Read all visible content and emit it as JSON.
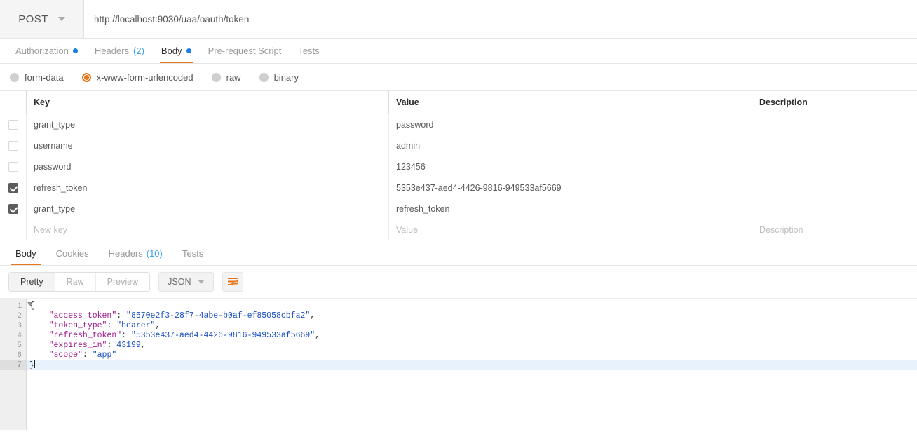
{
  "request": {
    "method": "POST",
    "url": "http://localhost:9030/uaa/oauth/token",
    "tabs": [
      {
        "label": "Authorization",
        "badge": "",
        "dot": true,
        "active": false
      },
      {
        "label": "Headers",
        "badge": "(2)",
        "dot": false,
        "active": false
      },
      {
        "label": "Body",
        "badge": "",
        "dot": true,
        "active": true
      },
      {
        "label": "Pre-request Script",
        "badge": "",
        "dot": false,
        "active": false
      },
      {
        "label": "Tests",
        "badge": "",
        "dot": false,
        "active": false
      }
    ],
    "body_types": [
      {
        "label": "form-data",
        "selected": false
      },
      {
        "label": "x-www-form-urlencoded",
        "selected": true
      },
      {
        "label": "raw",
        "selected": false
      },
      {
        "label": "binary",
        "selected": false
      }
    ],
    "table": {
      "headers": {
        "key": "Key",
        "value": "Value",
        "description": "Description"
      },
      "rows": [
        {
          "checked": false,
          "key": "grant_type",
          "value": "password",
          "description": ""
        },
        {
          "checked": false,
          "key": "username",
          "value": "admin",
          "description": ""
        },
        {
          "checked": false,
          "key": "password",
          "value": "123456",
          "description": ""
        },
        {
          "checked": true,
          "key": "refresh_token",
          "value": "5353e437-aed4-4426-9816-949533af5669",
          "description": ""
        },
        {
          "checked": true,
          "key": "grant_type",
          "value": "refresh_token",
          "description": ""
        }
      ],
      "new_row": {
        "key_placeholder": "New key",
        "value_placeholder": "Value",
        "description_placeholder": "Description"
      }
    }
  },
  "response": {
    "tabs": [
      {
        "label": "Body",
        "badge": "",
        "active": true
      },
      {
        "label": "Cookies",
        "badge": "",
        "active": false
      },
      {
        "label": "Headers",
        "badge": "(10)",
        "active": false
      },
      {
        "label": "Tests",
        "badge": "",
        "active": false
      }
    ],
    "view_modes": [
      {
        "label": "Pretty",
        "active": true
      },
      {
        "label": "Raw",
        "active": false
      },
      {
        "label": "Preview",
        "active": false
      }
    ],
    "format": "JSON",
    "wrap_icon": "word-wrap-icon",
    "body_lines": [
      {
        "n": "1",
        "fold": true,
        "current": false,
        "parts": [
          {
            "t": "pun",
            "s": "{"
          }
        ]
      },
      {
        "n": "2",
        "fold": false,
        "current": false,
        "parts": [
          {
            "t": "pun",
            "s": "    "
          },
          {
            "t": "key",
            "s": "\"access_token\""
          },
          {
            "t": "pun",
            "s": ": "
          },
          {
            "t": "str",
            "s": "\"8570e2f3-28f7-4abe-b0af-ef85058cbfa2\""
          },
          {
            "t": "pun",
            "s": ","
          }
        ]
      },
      {
        "n": "3",
        "fold": false,
        "current": false,
        "parts": [
          {
            "t": "pun",
            "s": "    "
          },
          {
            "t": "key",
            "s": "\"token_type\""
          },
          {
            "t": "pun",
            "s": ": "
          },
          {
            "t": "str",
            "s": "\"bearer\""
          },
          {
            "t": "pun",
            "s": ","
          }
        ]
      },
      {
        "n": "4",
        "fold": false,
        "current": false,
        "parts": [
          {
            "t": "pun",
            "s": "    "
          },
          {
            "t": "key",
            "s": "\"refresh_token\""
          },
          {
            "t": "pun",
            "s": ": "
          },
          {
            "t": "str",
            "s": "\"5353e437-aed4-4426-9816-949533af5669\""
          },
          {
            "t": "pun",
            "s": ","
          }
        ]
      },
      {
        "n": "5",
        "fold": false,
        "current": false,
        "parts": [
          {
            "t": "pun",
            "s": "    "
          },
          {
            "t": "key",
            "s": "\"expires_in\""
          },
          {
            "t": "pun",
            "s": ": "
          },
          {
            "t": "num",
            "s": "43199"
          },
          {
            "t": "pun",
            "s": ","
          }
        ]
      },
      {
        "n": "6",
        "fold": false,
        "current": false,
        "parts": [
          {
            "t": "pun",
            "s": "    "
          },
          {
            "t": "key",
            "s": "\"scope\""
          },
          {
            "t": "pun",
            "s": ": "
          },
          {
            "t": "str",
            "s": "\"app\""
          }
        ]
      },
      {
        "n": "7",
        "fold": false,
        "current": true,
        "parts": [
          {
            "t": "pun",
            "s": "}"
          }
        ]
      }
    ]
  },
  "colors": {
    "accent_orange": "#e8751a",
    "badge_blue": "#1a7ee8",
    "count_blue": "#3aa0e8",
    "json_key": "#a01a8d",
    "json_string": "#1a4fc4",
    "checkbox_on": "#5c5c5c"
  }
}
